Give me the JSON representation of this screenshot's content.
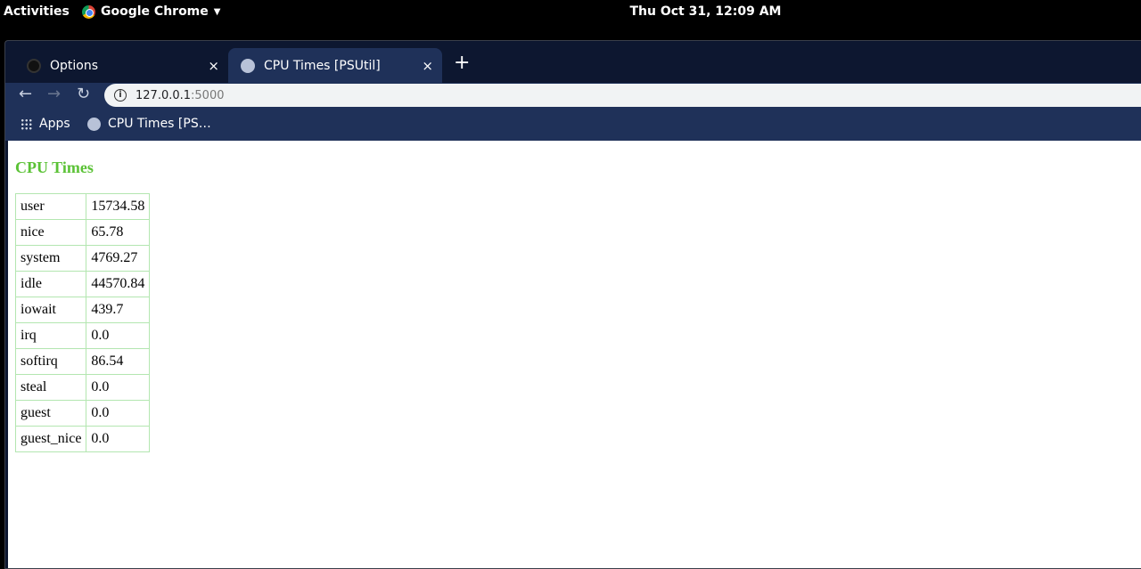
{
  "system": {
    "activities": "Activities",
    "app_name": "Google Chrome",
    "clock": "Thu Oct 31, 12:09 AM"
  },
  "browser": {
    "tabs": [
      {
        "title": "Options",
        "icon": "github-icon",
        "close": "×"
      },
      {
        "title": "CPU Times [PSUtil]",
        "icon": "globe-icon",
        "close": "×",
        "active": true
      }
    ],
    "new_tab": "+",
    "url_host": "127.0.0.1",
    "url_port": ":5000",
    "bookmarks": [
      {
        "label": "Apps",
        "icon": "apps-grid-icon"
      },
      {
        "label": "CPU Times [PS…",
        "icon": "globe-icon"
      }
    ]
  },
  "page": {
    "heading": "CPU Times",
    "heading_color": "#5bc236",
    "rows": [
      [
        "user",
        "15734.58"
      ],
      [
        "nice",
        "65.78"
      ],
      [
        "system",
        "4769.27"
      ],
      [
        "idle",
        "44570.84"
      ],
      [
        "iowait",
        "439.7"
      ],
      [
        "irq",
        "0.0"
      ],
      [
        "softirq",
        "86.54"
      ],
      [
        "steal",
        "0.0"
      ],
      [
        "guest",
        "0.0"
      ],
      [
        "guest_nice",
        "0.0"
      ]
    ]
  }
}
